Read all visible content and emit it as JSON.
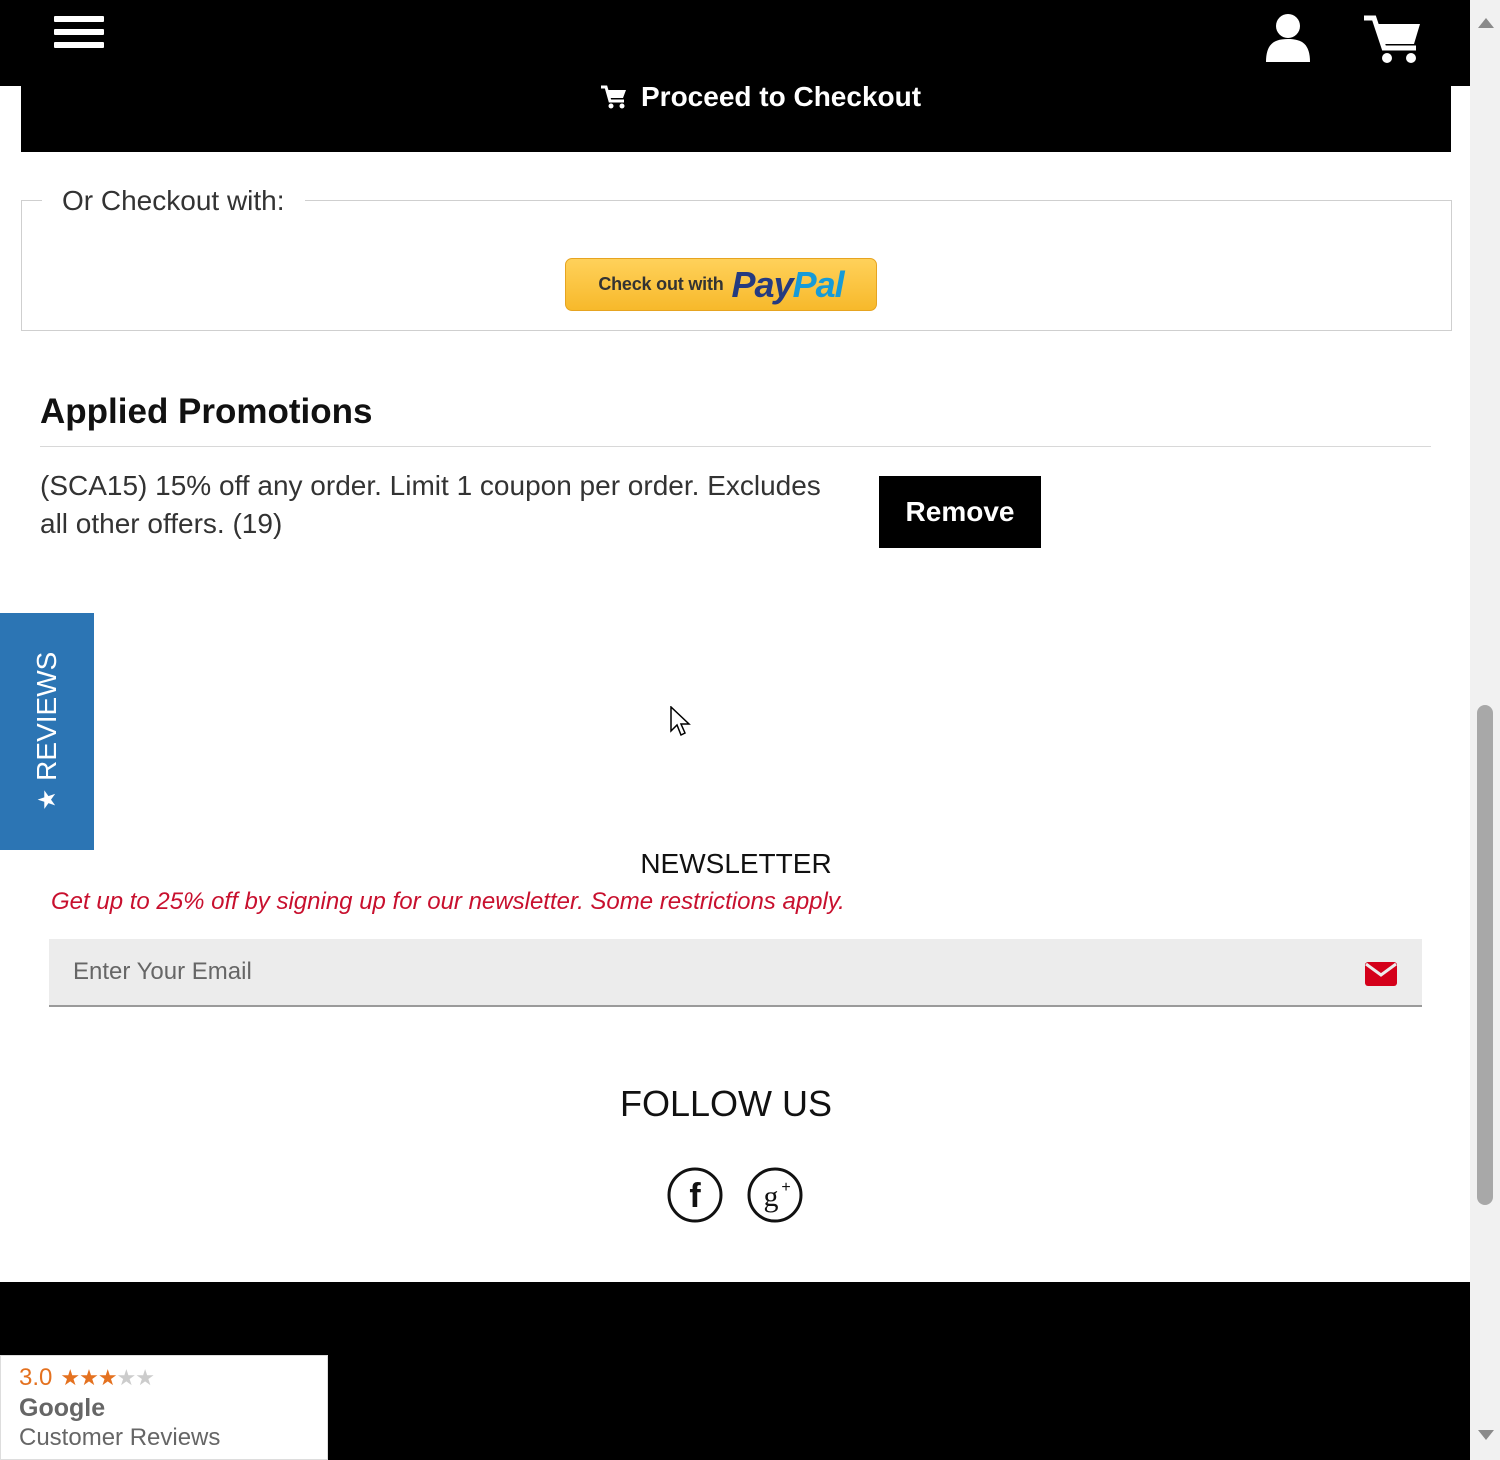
{
  "header": {
    "menu_icon": "hamburger-menu-icon",
    "account_icon": "user-icon",
    "cart_icon": "shopping-cart-icon"
  },
  "checkout": {
    "proceed_label": "Proceed to Checkout",
    "alt_legend": "Or Checkout with:",
    "paypal_prefix": "Check out with",
    "paypal_pay": "Pay",
    "paypal_pal": "Pal"
  },
  "promotions": {
    "title": "Applied Promotions",
    "items": [
      {
        "text": "(SCA15) 15% off any order. Limit 1 coupon per order. Excludes all other offers. (19)",
        "remove_label": "Remove"
      }
    ]
  },
  "reviews_tab": {
    "star": "★",
    "label": "REVIEWS"
  },
  "newsletter": {
    "title": "NEWSLETTER",
    "subtitle": "Get up to 25% off by signing up for our newsletter. Some restrictions apply.",
    "email_placeholder": "Enter Your Email",
    "submit_icon": "envelope-icon"
  },
  "follow": {
    "title": "FOLLOW US",
    "networks": [
      "facebook-icon",
      "google-plus-icon"
    ]
  },
  "google_badge": {
    "rating": "3.0",
    "stars_filled": 3,
    "stars_total": 5,
    "line1": "Google",
    "line2": "Customer Reviews"
  },
  "colors": {
    "header_bg": "#000000",
    "reviews_tab": "#2c75b4",
    "newsletter_accent": "#c8102e",
    "paypal_yellow": "#ffc439",
    "rating_orange": "#e4711f"
  }
}
